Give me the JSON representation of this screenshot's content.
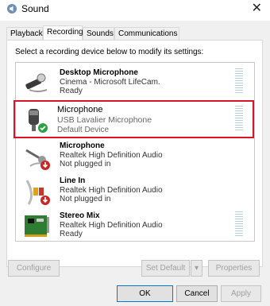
{
  "window": {
    "title": "Sound",
    "close_glyph": "✕"
  },
  "tabs": [
    {
      "label": "Playback"
    },
    {
      "label": "Recording",
      "active": true
    },
    {
      "label": "Sounds"
    },
    {
      "label": "Communications"
    }
  ],
  "instruction": "Select a recording device below to modify its settings:",
  "devices": [
    {
      "name": "Desktop Microphone",
      "description": "Cinema - Microsoft LifeCam.",
      "status": "Ready",
      "icon": "webcam-microphone-icon"
    },
    {
      "name": "Microphone",
      "description": "USB Lavalier Microphone",
      "status": "Default Device",
      "icon": "usb-microphone-icon",
      "selected": true,
      "default_badge": "green-check-badge"
    },
    {
      "name": "Microphone",
      "description": "Realtek High Definition Audio",
      "status": "Not plugged in",
      "icon": "microphone-icon",
      "unplugged_badge": "red-down-arrow-badge"
    },
    {
      "name": "Line In",
      "description": "Realtek High Definition Audio",
      "status": "Not plugged in",
      "icon": "line-in-cable-icon",
      "unplugged_badge": "red-down-arrow-badge"
    },
    {
      "name": "Stereo Mix",
      "description": "Realtek High Definition Audio",
      "status": "Ready",
      "icon": "sound-card-icon"
    }
  ],
  "buttons": {
    "configure": "Configure",
    "set_default": "Set Default",
    "set_default_dropdown": "▾",
    "properties": "Properties",
    "ok": "OK",
    "cancel": "Cancel",
    "apply": "Apply"
  },
  "colors": {
    "selection_highlight": "#d9142a",
    "level_meter": "#b8cde0",
    "ok_border": "#0078d7"
  }
}
